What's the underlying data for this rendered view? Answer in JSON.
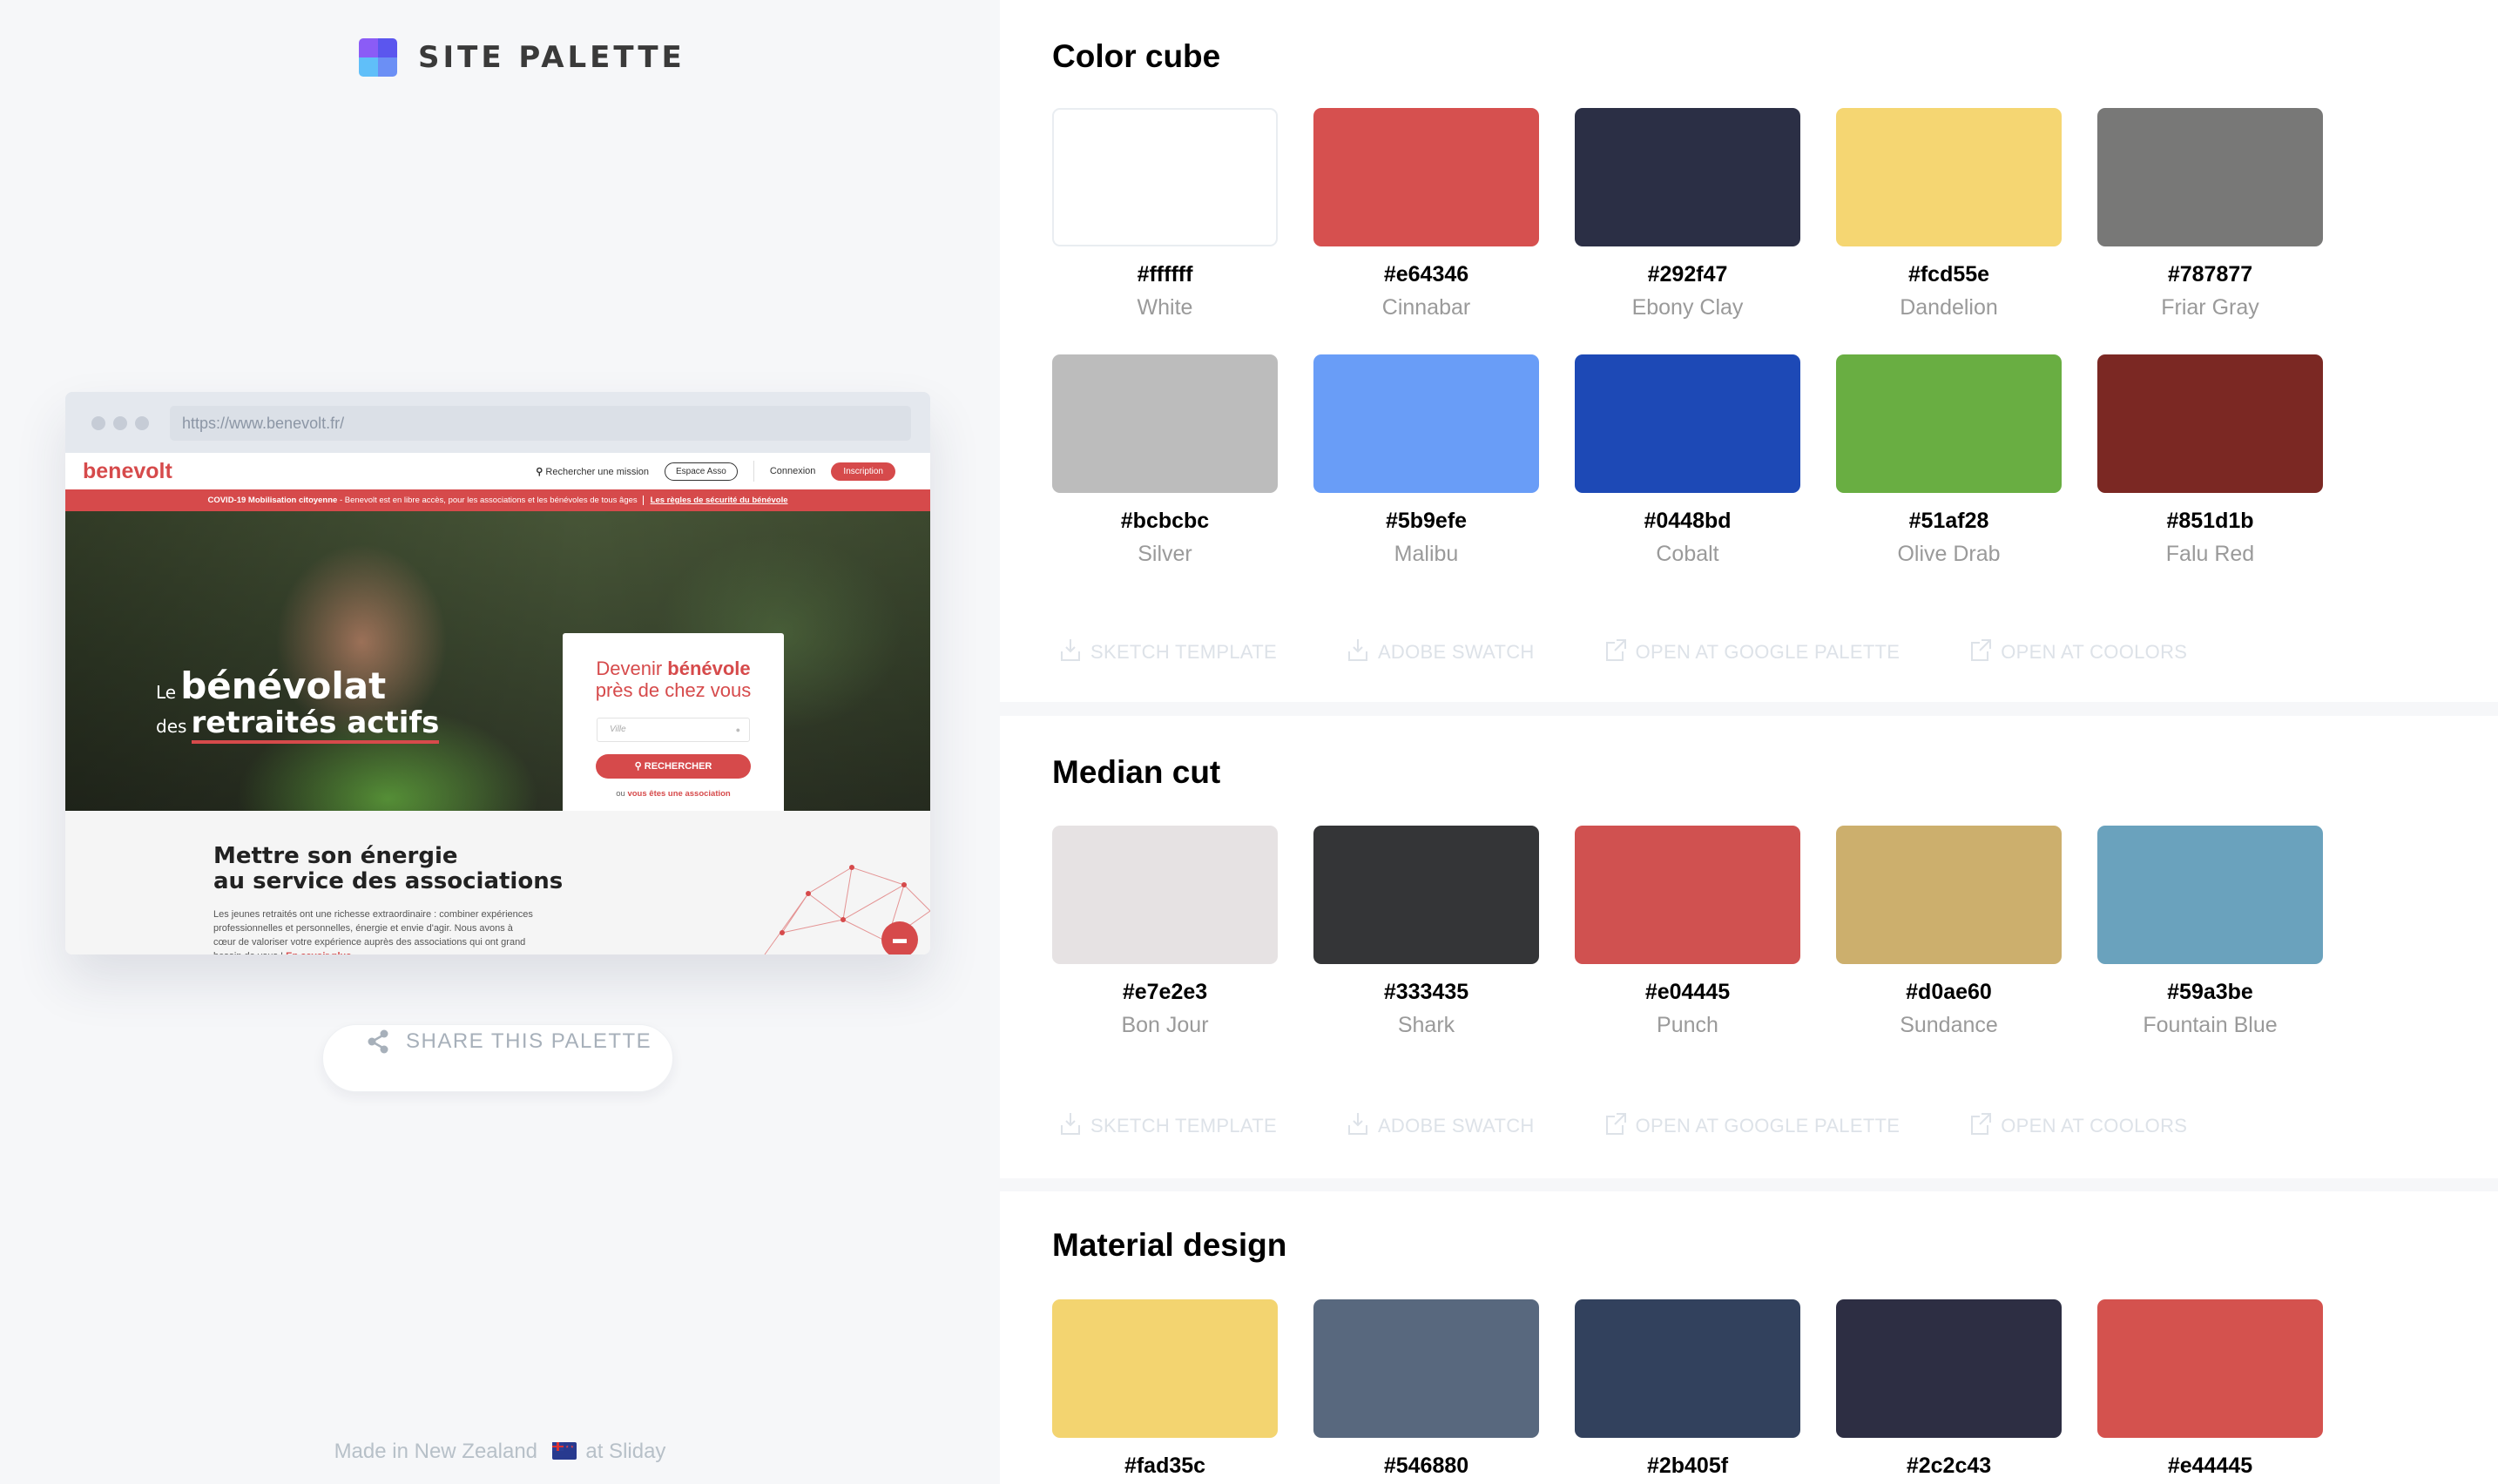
{
  "brand": {
    "name": "SITE PALETTE",
    "logo_colors": [
      "#8b5cf6",
      "#5b56ee",
      "#60bff9",
      "#6b8ff5"
    ]
  },
  "preview": {
    "url": "https://www.benevolt.fr/",
    "site_logo": "benevolt",
    "nav": {
      "search": "Rechercher une mission",
      "espace": "Espace Asso",
      "login": "Connexion",
      "signup": "Inscription"
    },
    "banner": {
      "bold": "COVID-19 Mobilisation citoyenne",
      "text": " - Benevolt est en libre accès, pour les associations et les bénévoles de tous âges",
      "link": "Les règles de sécurité du bénévole"
    },
    "hero": {
      "le": "Le",
      "benevolat": "bénévolat",
      "des": "des",
      "retraites": "retraités actifs"
    },
    "card": {
      "line1_a": "Devenir ",
      "line1_b": "bénévole",
      "line2": "près de chez vous",
      "input_placeholder": "Ville",
      "button": "RECHERCHER",
      "link_prefix": "ou ",
      "link": "vous êtes une association"
    },
    "lower": {
      "title_1": "Mettre son énergie",
      "title_2": "au service des associations",
      "text": "Les jeunes retraités ont une richesse extraordinaire : combiner expériences professionnelles et personnelles, énergie et envie d'agir. Nous avons à cœur de valoriser votre expérience auprès des associations qui ont grand besoin de vous ! ",
      "more": "En savoir plus"
    }
  },
  "share": {
    "label": "SHARE THIS PALETTE",
    "icon": "share-icon"
  },
  "footer": {
    "prefix": "Made in New Zealand",
    "suffix": "at Sliday",
    "flag": "new-zealand-flag"
  },
  "actions": [
    {
      "label": "SKETCH TEMPLATE",
      "icon": "download-icon"
    },
    {
      "label": "ADOBE SWATCH",
      "icon": "download-icon"
    },
    {
      "label": "OPEN AT GOOGLE PALETTE",
      "icon": "external-link-icon"
    },
    {
      "label": "OPEN AT COOLORS",
      "icon": "external-link-icon"
    }
  ],
  "sections": [
    {
      "title": "Color cube",
      "swatches": [
        {
          "hex": "#ffffff",
          "name": "White",
          "display": "#ffffff"
        },
        {
          "hex": "#e64346",
          "name": "Cinnabar",
          "display": "#d6504f"
        },
        {
          "hex": "#292f47",
          "name": "Ebony Clay",
          "display": "#2b2f45"
        },
        {
          "hex": "#fcd55e",
          "name": "Dandelion",
          "display": "#f5d672"
        },
        {
          "hex": "#787877",
          "name": "Friar Gray",
          "display": "#787877"
        },
        {
          "hex": "#bcbcbc",
          "name": "Silver",
          "display": "#bcbcbc"
        },
        {
          "hex": "#5b9efe",
          "name": "Malibu",
          "display": "#699df7"
        },
        {
          "hex": "#0448bd",
          "name": "Cobalt",
          "display": "#1d49b6"
        },
        {
          "hex": "#51af28",
          "name": "Olive Drab",
          "display": "#69ae42"
        },
        {
          "hex": "#851d1b",
          "name": "Falu Red",
          "display": "#7b2823"
        }
      ]
    },
    {
      "title": "Median cut",
      "swatches": [
        {
          "hex": "#e7e2e3",
          "name": "Bon Jour",
          "display": "#e6e2e3"
        },
        {
          "hex": "#333435",
          "name": "Shark",
          "display": "#343537"
        },
        {
          "hex": "#e04445",
          "name": "Punch",
          "display": "#d05150"
        },
        {
          "hex": "#d0ae60",
          "name": "Sundance",
          "display": "#ccaf6d"
        },
        {
          "hex": "#59a3be",
          "name": "Fountain Blue",
          "display": "#6aa2bd"
        }
      ]
    },
    {
      "title": "Material design",
      "swatches": [
        {
          "hex": "#fad35c",
          "name": "",
          "display": "#f3d470"
        },
        {
          "hex": "#546880",
          "name": "",
          "display": "#58687e"
        },
        {
          "hex": "#2b405f",
          "name": "",
          "display": "#32415d"
        },
        {
          "hex": "#2c2c43",
          "name": "",
          "display": "#2d2e43"
        },
        {
          "hex": "#e44445",
          "name": "",
          "display": "#d4524e"
        }
      ]
    }
  ]
}
